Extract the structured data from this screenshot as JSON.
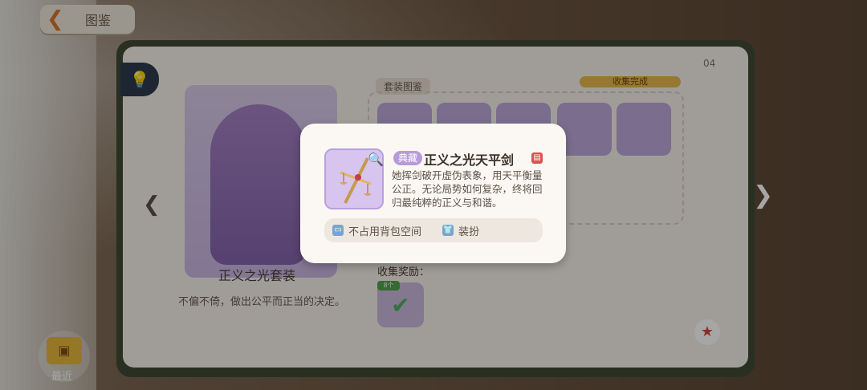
{
  "header": {
    "title": "图鉴"
  },
  "page_number": "04",
  "set": {
    "name": "正义之光套装",
    "description": "不偏不倚，做出公平而正当的决定。",
    "section_label": "套装图鉴",
    "status": "收集完成",
    "reward_label": "收集奖励：",
    "reward_badge": "8个"
  },
  "sidebar": {
    "recent_label": "最近"
  },
  "popup": {
    "tag": "典藏",
    "item_name": "正义之光天平剑",
    "description": "她挥剑破开虚伪表象，用天平衡量公正。无论局势如何复杂，终将回归最纯粹的正义与和谐。",
    "info": [
      {
        "label": "不占用背包空间",
        "icon": "backpack-icon"
      },
      {
        "label": "装扮",
        "icon": "shirt-icon"
      }
    ]
  },
  "colors": {
    "accent": "#b79ad9",
    "badge_gold": "#e9b84a",
    "back_orange": "#d9762b"
  }
}
